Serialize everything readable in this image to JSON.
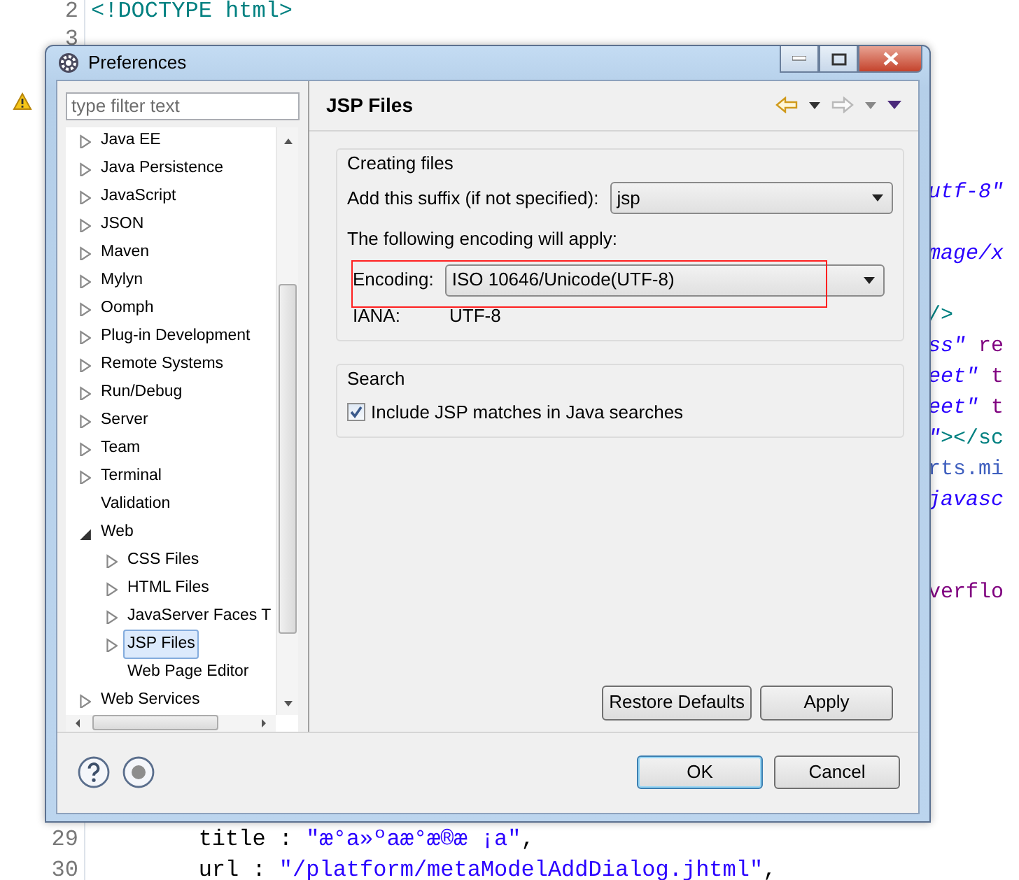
{
  "editor": {
    "lines": [
      {
        "number": "2",
        "segments": [
          {
            "kind": "tag",
            "text": "<!DOCTYPE html>"
          }
        ]
      },
      {
        "number": "3"
      },
      {
        "warning": true
      },
      {
        "tail": true,
        "segments": [
          {
            "kind": "string",
            "text": "utf-8\""
          }
        ]
      },
      {
        "tail": true,
        "segments": [
          {
            "kind": "string",
            "text": "mage/x"
          }
        ]
      },
      {
        "tail": true,
        "segments": [
          {
            "kind": "tag",
            "text": "/>"
          }
        ]
      },
      {
        "tail": true,
        "segments": [
          {
            "kind": "string",
            "text": "ss\""
          },
          {
            "kind": "attr",
            "text": " re"
          }
        ]
      },
      {
        "tail": true,
        "segments": [
          {
            "kind": "string",
            "text": "eet\""
          },
          {
            "kind": "attr",
            "text": " t"
          }
        ]
      },
      {
        "tail": true,
        "segments": [
          {
            "kind": "string",
            "text": "eet\""
          },
          {
            "kind": "attr",
            "text": " t"
          }
        ]
      },
      {
        "tail": true,
        "segments": [
          {
            "kind": "string",
            "text": "\""
          },
          {
            "kind": "tag",
            "text": "></sc"
          }
        ]
      },
      {
        "tail": true,
        "segments": [
          {
            "kind": "plainstring",
            "text": "rts.mi"
          }
        ]
      },
      {
        "tail": true,
        "segments": [
          {
            "kind": "string",
            "text": "javasc"
          }
        ]
      },
      {
        "tail": true,
        "segments": [
          {
            "kind": "attr",
            "text": "verflo"
          }
        ]
      },
      {
        "number": "29",
        "segments": [
          {
            "kind": "plain",
            "text": "        title : "
          },
          {
            "kind": "jsstring",
            "text": "\"æ°a»ºaæ°æ®æ ¡a\""
          },
          {
            "kind": "plain",
            "text": ","
          }
        ]
      },
      {
        "number": "30",
        "segments": [
          {
            "kind": "plain",
            "text": "        url : "
          },
          {
            "kind": "jsstring",
            "text": "\"/platform/metaModelAddDialog.jhtml\""
          },
          {
            "kind": "plain",
            "text": ","
          }
        ]
      }
    ]
  },
  "dialog": {
    "title": "Preferences",
    "filter": {
      "placeholder": "type filter text"
    },
    "tree": [
      {
        "label": "Java EE",
        "expandable": true,
        "expanded": false,
        "selected": false
      },
      {
        "label": "Java Persistence",
        "expandable": true,
        "expanded": false,
        "selected": false
      },
      {
        "label": "JavaScript",
        "expandable": true,
        "expanded": false,
        "selected": false
      },
      {
        "label": "JSON",
        "expandable": true,
        "expanded": false,
        "selected": false
      },
      {
        "label": "Maven",
        "expandable": true,
        "expanded": false,
        "selected": false
      },
      {
        "label": "Mylyn",
        "expandable": true,
        "expanded": false,
        "selected": false
      },
      {
        "label": "Oomph",
        "expandable": true,
        "expanded": false,
        "selected": false
      },
      {
        "label": "Plug-in Development",
        "expandable": true,
        "expanded": false,
        "selected": false
      },
      {
        "label": "Remote Systems",
        "expandable": true,
        "expanded": false,
        "selected": false
      },
      {
        "label": "Run/Debug",
        "expandable": true,
        "expanded": false,
        "selected": false
      },
      {
        "label": "Server",
        "expandable": true,
        "expanded": false,
        "selected": false
      },
      {
        "label": "Team",
        "expandable": true,
        "expanded": false,
        "selected": false
      },
      {
        "label": "Terminal",
        "expandable": true,
        "expanded": false,
        "selected": false
      },
      {
        "label": "Validation",
        "expandable": false,
        "selected": false
      },
      {
        "label": "Web",
        "expandable": true,
        "expanded": true,
        "selected": false,
        "children": [
          {
            "label": "CSS Files",
            "expandable": true,
            "expanded": false,
            "selected": false
          },
          {
            "label": "HTML Files",
            "expandable": true,
            "expanded": false,
            "selected": false
          },
          {
            "label": "JavaServer Faces T",
            "expandable": true,
            "expanded": false,
            "selected": false
          },
          {
            "label": "JSP Files",
            "expandable": true,
            "expanded": false,
            "selected": true
          },
          {
            "label": "Web Page Editor",
            "expandable": false,
            "selected": false
          }
        ]
      },
      {
        "label": "Web Services",
        "expandable": true,
        "expanded": false,
        "selected": false
      }
    ],
    "page": {
      "title": "JSP Files",
      "creating_files": {
        "title": "Creating files",
        "suffix": {
          "label": "Add this suffix (if not specified):",
          "value": "jsp"
        },
        "note": "The following encoding will apply:",
        "encoding": {
          "label": "Encoding:",
          "value": "ISO 10646/Unicode(UTF-8)",
          "highlighted": true
        },
        "iana": {
          "label": "IANA:",
          "value": "UTF-8"
        }
      },
      "search": {
        "title": "Search",
        "options": [
          {
            "label": "Include JSP matches in Java searches",
            "checked": true
          }
        ]
      },
      "buttons": [
        "Restore Defaults",
        "Apply"
      ]
    },
    "footer_buttons": [
      {
        "label": "OK",
        "default": true
      },
      {
        "label": "Cancel",
        "default": false
      }
    ]
  }
}
